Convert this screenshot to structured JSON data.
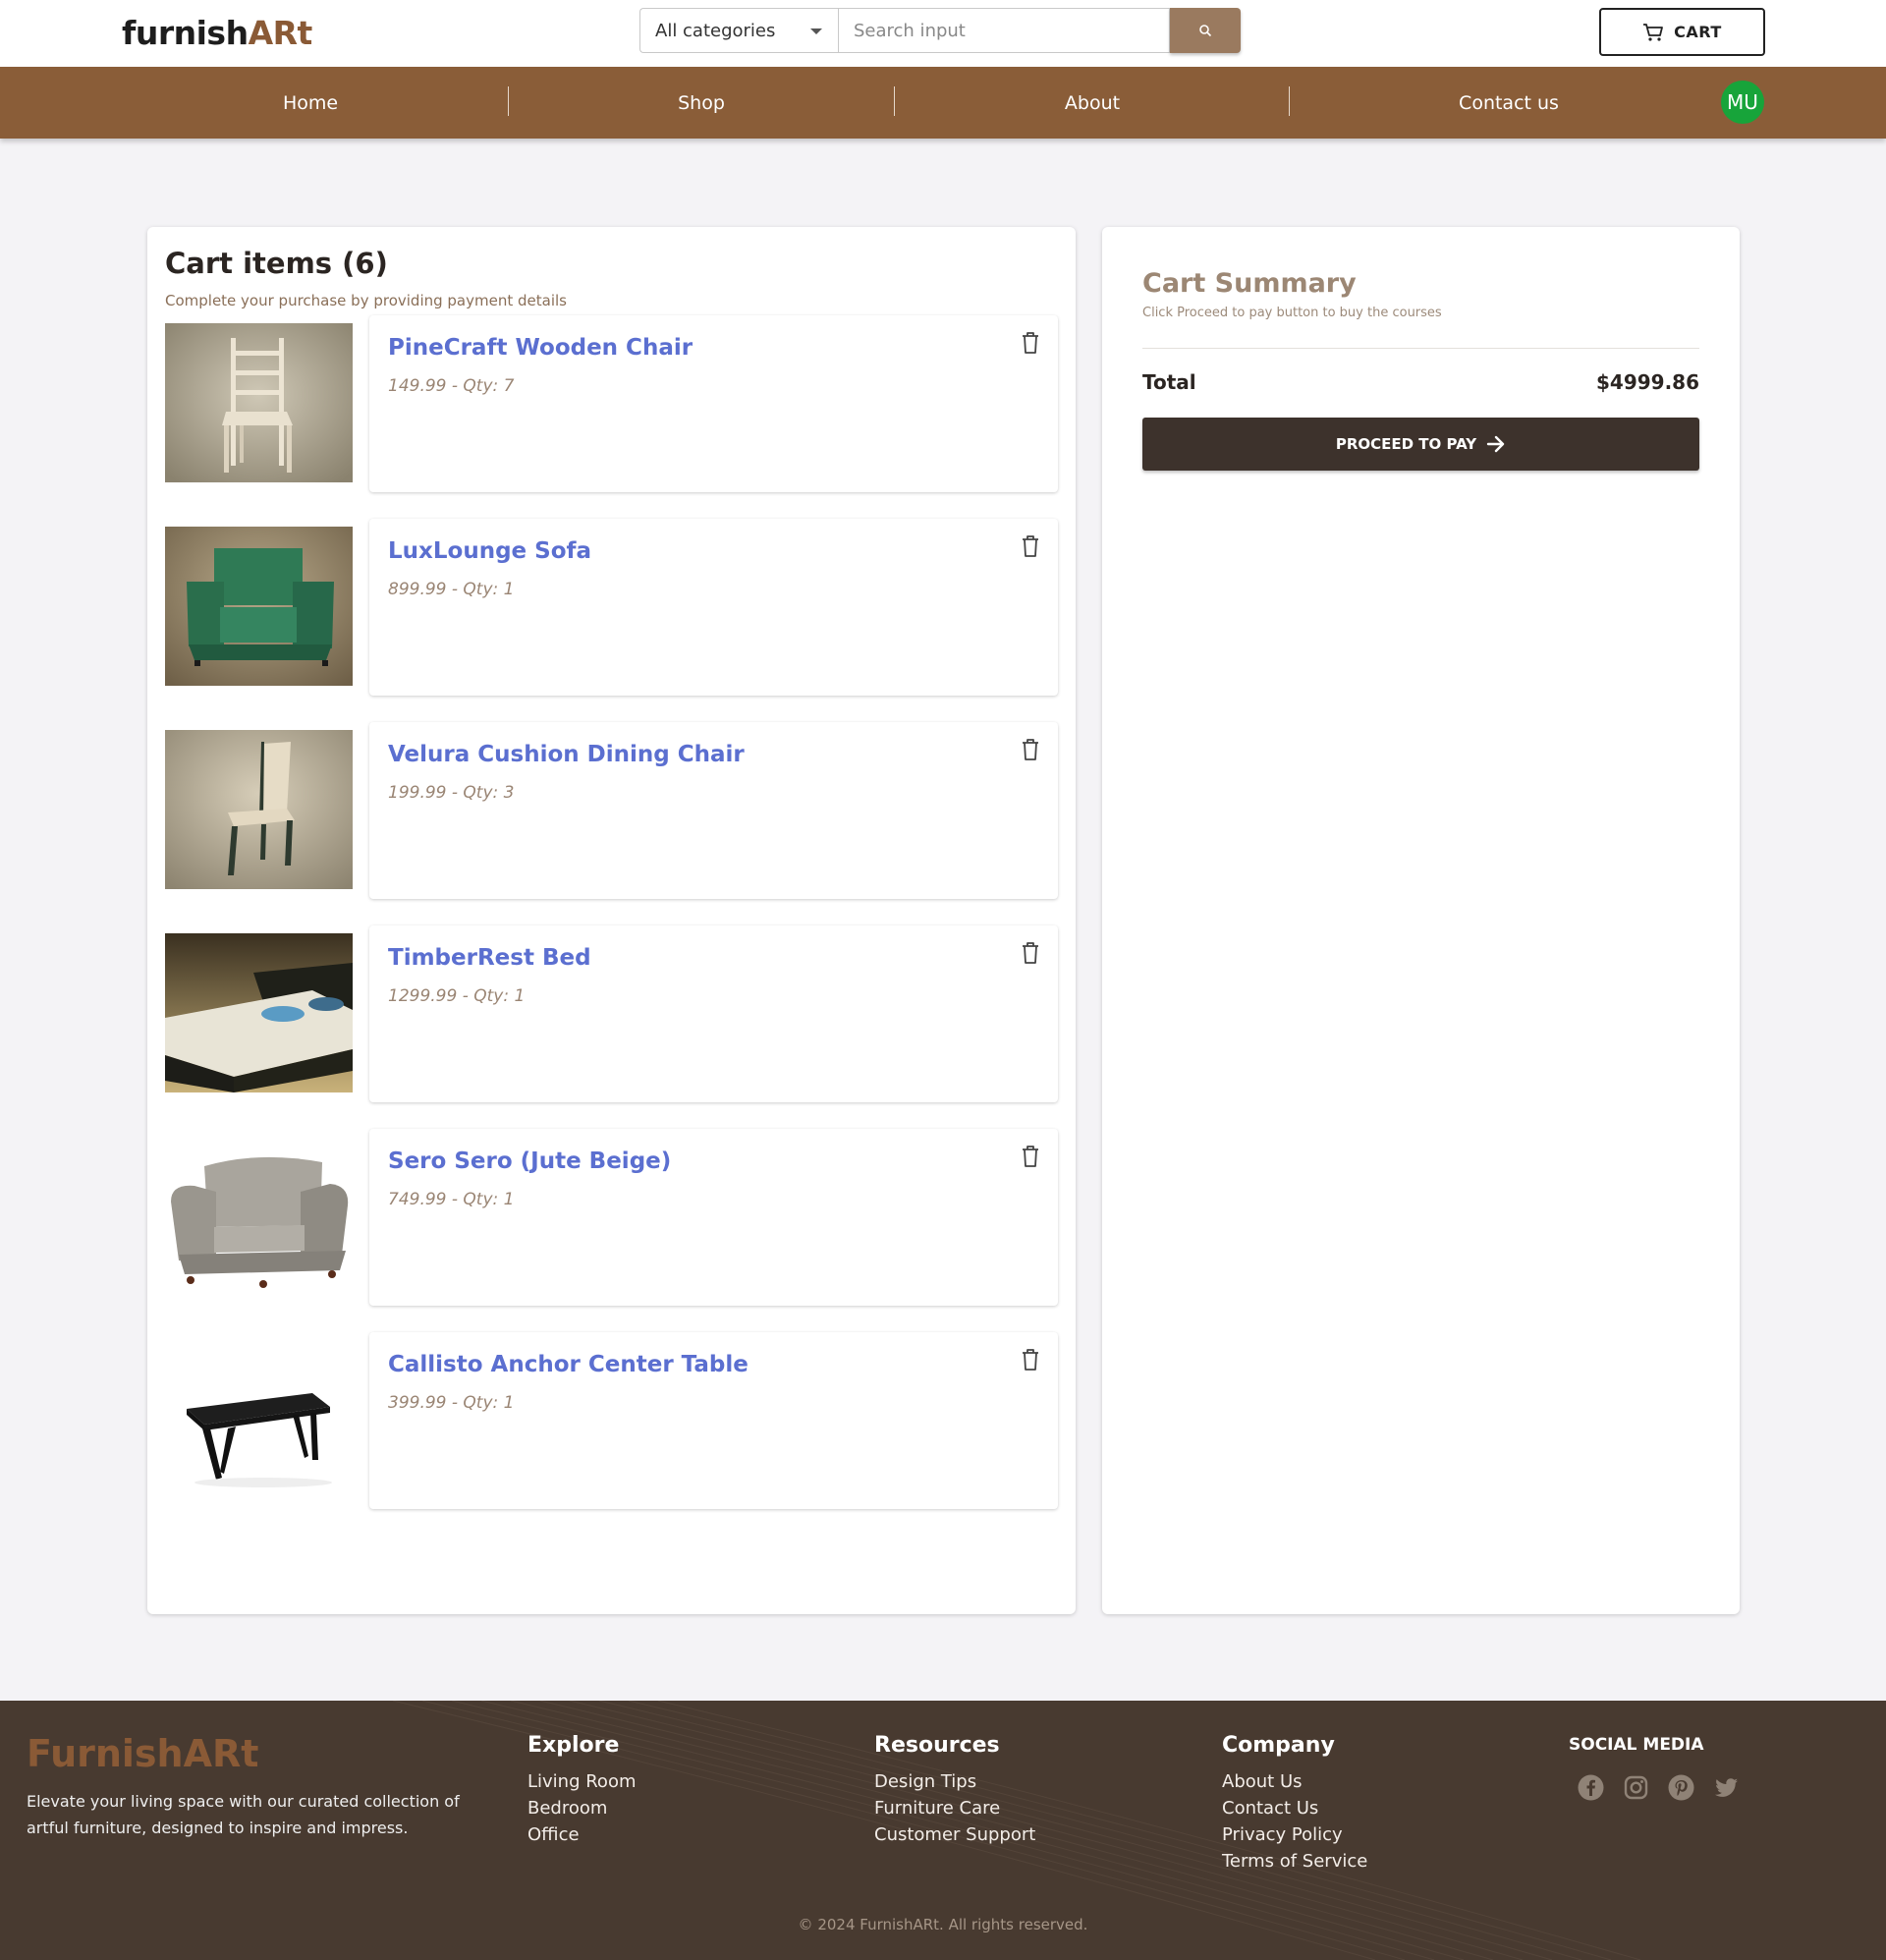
{
  "header": {
    "logo_text": "furnish",
    "logo_accent": "ARt",
    "category_select": "All categories",
    "search_placeholder": "Search input",
    "cart_label": "CART"
  },
  "nav": {
    "items": [
      "Home",
      "Shop",
      "About",
      "Contact us"
    ],
    "avatar_initials": "MU"
  },
  "cart": {
    "title": "Cart items (6)",
    "subtitle": "Complete your purchase by providing payment details",
    "items": [
      {
        "name": "PineCraft Wooden Chair",
        "meta": "149.99 - Qty: 7",
        "image": "wooden-chair"
      },
      {
        "name": "LuxLounge Sofa",
        "meta": "899.99 - Qty: 1",
        "image": "green-armchair"
      },
      {
        "name": "Velura Cushion Dining Chair",
        "meta": "199.99 - Qty: 3",
        "image": "dining-chair"
      },
      {
        "name": "TimberRest Bed",
        "meta": "1299.99 - Qty: 1",
        "image": "bed"
      },
      {
        "name": "Sero Sero (Jute Beige)",
        "meta": "749.99 - Qty: 1",
        "image": "beige-armchair"
      },
      {
        "name": "Callisto Anchor Center Table",
        "meta": "399.99 - Qty: 1",
        "image": "black-table"
      }
    ]
  },
  "summary": {
    "title": "Cart Summary",
    "subtitle": "Click Proceed to pay button to buy the courses",
    "total_label": "Total",
    "total_value": "$4999.86",
    "pay_button": "PROCEED TO PAY"
  },
  "footer": {
    "brand": "FurnishARt",
    "description": "Elevate your living space with our curated collection of artful furniture, designed to inspire and impress.",
    "columns": [
      {
        "title": "Explore",
        "links": [
          "Living Room",
          "Bedroom",
          "Office"
        ]
      },
      {
        "title": "Resources",
        "links": [
          "Design Tips",
          "Furniture Care",
          "Customer Support"
        ]
      },
      {
        "title": "Company",
        "links": [
          "About Us",
          "Contact Us",
          "Privacy Policy",
          "Terms of Service"
        ]
      }
    ],
    "social_title": "SOCIAL MEDIA",
    "social_icons": [
      "facebook-icon",
      "instagram-icon",
      "pinterest-icon",
      "twitter-icon"
    ],
    "copyright": "© 2024 FurnishARt. All rights reserved."
  },
  "colors": {
    "nav": "#8a5d38",
    "accent_link": "#5b6fd0",
    "avatar": "#17a43a",
    "pay_button": "#3d322c",
    "footer": "#483a30"
  }
}
